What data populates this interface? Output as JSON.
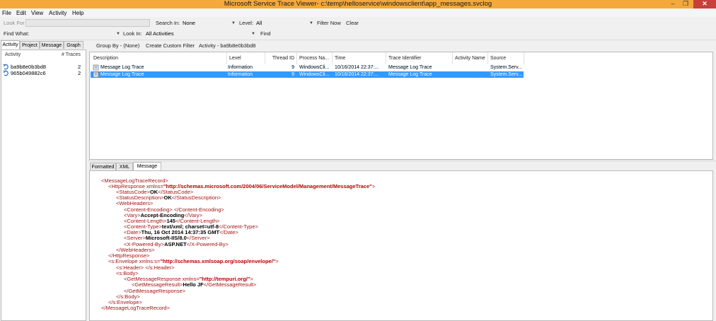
{
  "window": {
    "title": "Microsoft Service Trace Viewer- c:\\temp\\helloservice\\windowsclient\\app_messages.svclog",
    "minimize": "–",
    "maximize": "❐",
    "close": "✕"
  },
  "menu": [
    "File",
    "Edit",
    "View",
    "Activity",
    "Help"
  ],
  "search_bar": {
    "look_for_label": "Look For",
    "look_for_value": "",
    "search_in_label": "Search In:",
    "search_in_value": "None",
    "level_label": "Level:",
    "level_value": "All",
    "filter_now": "Filter Now",
    "clear": "Clear"
  },
  "find_bar": {
    "find_what_label": "Find What:",
    "find_what_value": "",
    "look_in_label": "Look In:",
    "look_in_value": "All Activities",
    "find": "Find"
  },
  "left_tabs": [
    "Activity",
    "Project",
    "Message",
    "Graph"
  ],
  "activity_list": {
    "headers": [
      "Activity",
      "# Traces"
    ],
    "rows": [
      {
        "name": "ba9b8e0b3bd8",
        "traces": "2"
      },
      {
        "name": "965b049882c6",
        "traces": "2"
      }
    ]
  },
  "grid_toolbar": {
    "group_by": "Group By - (None)",
    "create_filter": "Create Custom Filter",
    "activity": "Activity - ba9b8e0b3bd8"
  },
  "trace_grid": {
    "headers": [
      "Description",
      "Level",
      "Thread ID",
      "Process Na...",
      "Time",
      "Trace Identifier",
      "Activity Name",
      "Source"
    ],
    "rows": [
      {
        "description": "Message Log Trace",
        "level": "Information",
        "thread": "9",
        "process": "WindowsCli...",
        "time": "10/16/2014  22:37:...",
        "trace_id": "Message Log Trace",
        "activity_name": "",
        "source": "System.Serv..."
      },
      {
        "description": "Message Log Trace",
        "level": "Information",
        "thread": "9",
        "process": "WindowsCli...",
        "time": "10/16/2014  22:37:...",
        "trace_id": "Message Log Trace",
        "activity_name": "",
        "source": "System.Serv..."
      }
    ]
  },
  "detail_tabs": [
    "Formatted",
    "XML",
    "Message"
  ],
  "xml": {
    "l1": "<MessageLogTraceRecord>",
    "l2_tag": "<HttpResponse xmlns=",
    "l2_val": "\"http://schemas.microsoft.com/2004/06/ServiceModel/Management/MessageTrace\"",
    "l2_end": ">",
    "l3_open": "<StatusCode>",
    "l3_val": "OK",
    "l3_close": "</StatusCode>",
    "l4_open": "<StatusDescription>",
    "l4_val": "OK",
    "l4_close": "</StatusDescription>",
    "l5": "<WebHeaders>",
    "l6": "<Content-Encoding> </Content-Encoding>",
    "l7_open": "<Vary>",
    "l7_val": "Accept-Encoding",
    "l7_close": "</Vary>",
    "l8_open": "<Content-Length>",
    "l8_val": "145",
    "l8_close": "</Content-Length>",
    "l9_open": "<Content-Type>",
    "l9_val": "text/xml; charset=utf-8",
    "l9_close": "</Content-Type>",
    "l10_open": "<Date>",
    "l10_val": "Thu, 16 Oct 2014 14:37:35 GMT",
    "l10_close": "</Date>",
    "l11_open": "<Server>",
    "l11_val": "Microsoft-IIS/8.0",
    "l11_close": "</Server>",
    "l12_open": "<X-Powered-By>",
    "l12_val": "ASP.NET",
    "l12_close": "</X-Powered-By>",
    "l13": "</WebHeaders>",
    "l14": "</HttpResponse>",
    "l15_tag": "<s:Envelope xmlns:s=",
    "l15_val": "\"http://schemas.xmlsoap.org/soap/envelope/\"",
    "l15_end": ">",
    "l16": "<s:Header> </s:Header>",
    "l17": "<s:Body>",
    "l18_tag": "<GetMessageResponse xmlns=",
    "l18_val": "\"http://tempuri.org/\"",
    "l18_end": ">",
    "l19_open": "<GetMessageResult>",
    "l19_val": "Hello JF",
    "l19_close": "</GetMessageResult>",
    "l20": "</GetMessageResponse>",
    "l21": "</s:Body>",
    "l22": "</s:Envelope>",
    "l23": "</MessageLogTraceRecord>"
  },
  "colors": {
    "titlebar": "#f3a93c",
    "close": "#c7403a",
    "selection": "#3399ff",
    "xml_tag": "#a31515",
    "xml_attr_value": "#0000ff"
  }
}
